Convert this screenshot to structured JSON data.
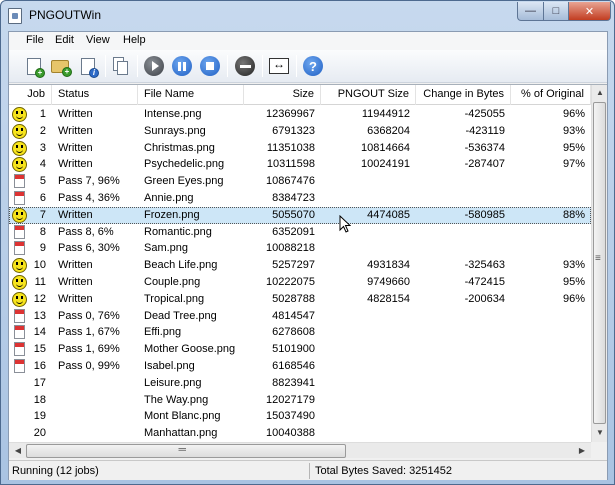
{
  "window": {
    "title": "PNGOUTWin"
  },
  "menu": [
    "File",
    "Edit",
    "View",
    "Help"
  ],
  "toolbar": [
    "add-file-icon",
    "add-folder-icon",
    "file-info-icon",
    "copy-icon",
    "play-icon",
    "pause-icon",
    "stop-icon",
    "remove-icon",
    "fit-columns-icon",
    "help-icon"
  ],
  "table": {
    "columns": [
      "Job",
      "Status",
      "File Name",
      "Size",
      "PNGOUT Size",
      "Change in Bytes",
      "% of Original"
    ],
    "rows": [
      {
        "icon": "smiley",
        "job": "1",
        "status": "Written",
        "file": "Intense.png",
        "size": "12369967",
        "pngout": "11944912",
        "change": "-425055",
        "pct": "96%"
      },
      {
        "icon": "smiley",
        "job": "2",
        "status": "Written",
        "file": "Sunrays.png",
        "size": "6791323",
        "pngout": "6368204",
        "change": "-423119",
        "pct": "93%"
      },
      {
        "icon": "smiley",
        "job": "3",
        "status": "Written",
        "file": "Christmas.png",
        "size": "11351038",
        "pngout": "10814664",
        "change": "-536374",
        "pct": "95%"
      },
      {
        "icon": "smiley",
        "job": "4",
        "status": "Written",
        "file": "Psychedelic.png",
        "size": "10311598",
        "pngout": "10024191",
        "change": "-287407",
        "pct": "97%"
      },
      {
        "icon": "file",
        "job": "5",
        "status": "Pass 7, 96%",
        "file": "Green Eyes.png",
        "size": "10867476",
        "pngout": "",
        "change": "",
        "pct": ""
      },
      {
        "icon": "file",
        "job": "6",
        "status": "Pass 4, 36%",
        "file": "Annie.png",
        "size": "8384723",
        "pngout": "",
        "change": "",
        "pct": ""
      },
      {
        "icon": "smiley",
        "job": "7",
        "status": "Written",
        "file": "Frozen.png",
        "size": "5055070",
        "pngout": "4474085",
        "change": "-580985",
        "pct": "88%",
        "selected": true
      },
      {
        "icon": "file",
        "job": "8",
        "status": "Pass 8, 6%",
        "file": "Romantic.png",
        "size": "6352091",
        "pngout": "",
        "change": "",
        "pct": ""
      },
      {
        "icon": "file",
        "job": "9",
        "status": "Pass 6, 30%",
        "file": "Sam.png",
        "size": "10088218",
        "pngout": "",
        "change": "",
        "pct": ""
      },
      {
        "icon": "smiley",
        "job": "10",
        "status": "Written",
        "file": "Beach Life.png",
        "size": "5257297",
        "pngout": "4931834",
        "change": "-325463",
        "pct": "93%"
      },
      {
        "icon": "smiley",
        "job": "11",
        "status": "Written",
        "file": "Couple.png",
        "size": "10222075",
        "pngout": "9749660",
        "change": "-472415",
        "pct": "95%"
      },
      {
        "icon": "smiley",
        "job": "12",
        "status": "Written",
        "file": "Tropical.png",
        "size": "5028788",
        "pngout": "4828154",
        "change": "-200634",
        "pct": "96%"
      },
      {
        "icon": "file",
        "job": "13",
        "status": "Pass 0, 76%",
        "file": "Dead Tree.png",
        "size": "4814547",
        "pngout": "",
        "change": "",
        "pct": ""
      },
      {
        "icon": "file",
        "job": "14",
        "status": "Pass 1, 67%",
        "file": "Effi.png",
        "size": "6278608",
        "pngout": "",
        "change": "",
        "pct": ""
      },
      {
        "icon": "file",
        "job": "15",
        "status": "Pass 1, 69%",
        "file": "Mother Goose.png",
        "size": "5101900",
        "pngout": "",
        "change": "",
        "pct": ""
      },
      {
        "icon": "file",
        "job": "16",
        "status": "Pass 0, 99%",
        "file": "Isabel.png",
        "size": "6168546",
        "pngout": "",
        "change": "",
        "pct": ""
      },
      {
        "icon": "",
        "job": "17",
        "status": "",
        "file": "Leisure.png",
        "size": "8823941",
        "pngout": "",
        "change": "",
        "pct": ""
      },
      {
        "icon": "",
        "job": "18",
        "status": "",
        "file": "The Way.png",
        "size": "12027179",
        "pngout": "",
        "change": "",
        "pct": ""
      },
      {
        "icon": "",
        "job": "19",
        "status": "",
        "file": "Mont Blanc.png",
        "size": "15037490",
        "pngout": "",
        "change": "",
        "pct": ""
      },
      {
        "icon": "",
        "job": "20",
        "status": "",
        "file": "Manhattan.png",
        "size": "10040388",
        "pngout": "",
        "change": "",
        "pct": ""
      }
    ]
  },
  "status": {
    "left": "Running (12 jobs)",
    "right": "Total Bytes Saved: 3251452"
  }
}
